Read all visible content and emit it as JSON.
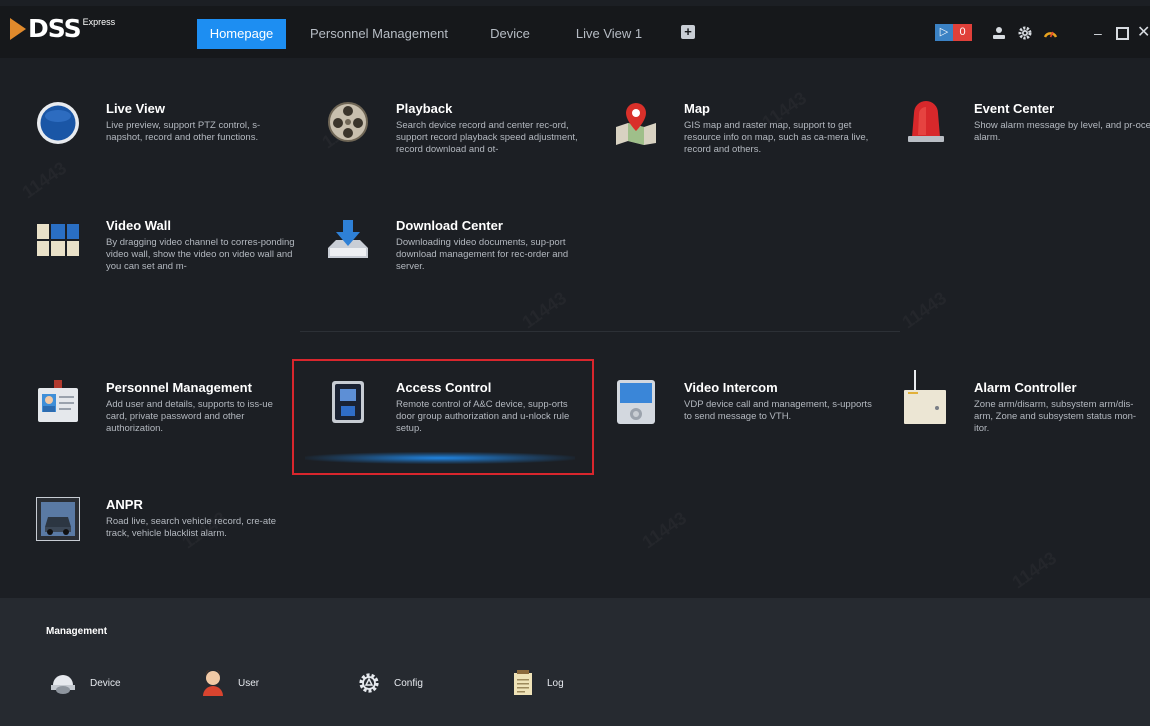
{
  "app": {
    "logo_text": "DSS",
    "logo_sup": "Express"
  },
  "tabs": [
    {
      "label": "Homepage",
      "active": true
    },
    {
      "label": "Personnel Management",
      "active": false
    },
    {
      "label": "Device",
      "active": false
    },
    {
      "label": "Live View 1",
      "active": false
    }
  ],
  "add_tab_symbol": "+",
  "toolbar": {
    "alarm_count": "0",
    "icons": [
      "volume-icon",
      "user-icon",
      "gear-icon",
      "speedometer-icon",
      "minimize-icon",
      "maximize-icon",
      "close-icon"
    ]
  },
  "modules": [
    {
      "title": "Live View",
      "desc": "Live preview, support PTZ control, s-napshot, record and other functions.",
      "icon": "live-view-icon"
    },
    {
      "title": "Playback",
      "desc": "Search device record and center rec-ord, support record playback speed adjustment, record download and ot-",
      "icon": "film-reel-icon"
    },
    {
      "title": "Map",
      "desc": "GIS map and raster map, support to get resource info on map, such as ca-mera live, record and others.",
      "icon": "map-pin-icon"
    },
    {
      "title": "Event Center",
      "desc": "Show alarm message by level, and pr-ocess alarm.",
      "icon": "alarm-light-icon"
    },
    {
      "title": "Video Wall",
      "desc": "By dragging video channel to corres-ponding video wall, show the video on video wall and you can set and m-",
      "icon": "video-wall-icon"
    },
    {
      "title": "Download Center",
      "desc": "Downloading video documents, sup-port download management for rec-order and server.",
      "icon": "download-tray-icon"
    },
    {
      "title": "Personnel Management",
      "desc": "Add user and details, supports to iss-ue card, private password and other authorization.",
      "icon": "id-badge-icon"
    },
    {
      "title": "Access Control",
      "desc": "Remote control of A&C device, supp-orts door group authorization and u-nlock rule setup.",
      "icon": "access-terminal-icon"
    },
    {
      "title": "Video Intercom",
      "desc": "VDP device call and management, s-upports to send message to VTH.",
      "icon": "intercom-icon"
    },
    {
      "title": "Alarm Controller",
      "desc": "Zone arm/disarm, subsystem arm/dis-arm, Zone and subsystem status mon-itor.",
      "icon": "alarm-controller-icon"
    },
    {
      "title": "ANPR",
      "desc": "Road live, search vehicle record, cre-ate track, vehicle blacklist alarm.",
      "icon": "vehicle-camera-icon"
    }
  ],
  "management": {
    "title": "Management",
    "items": [
      {
        "label": "Device",
        "icon": "camera-dome-icon"
      },
      {
        "label": "User",
        "icon": "user-avatar-icon"
      },
      {
        "label": "Config",
        "icon": "gear-icon"
      },
      {
        "label": "Log",
        "icon": "notepad-icon"
      }
    ]
  },
  "watermark": "11443"
}
